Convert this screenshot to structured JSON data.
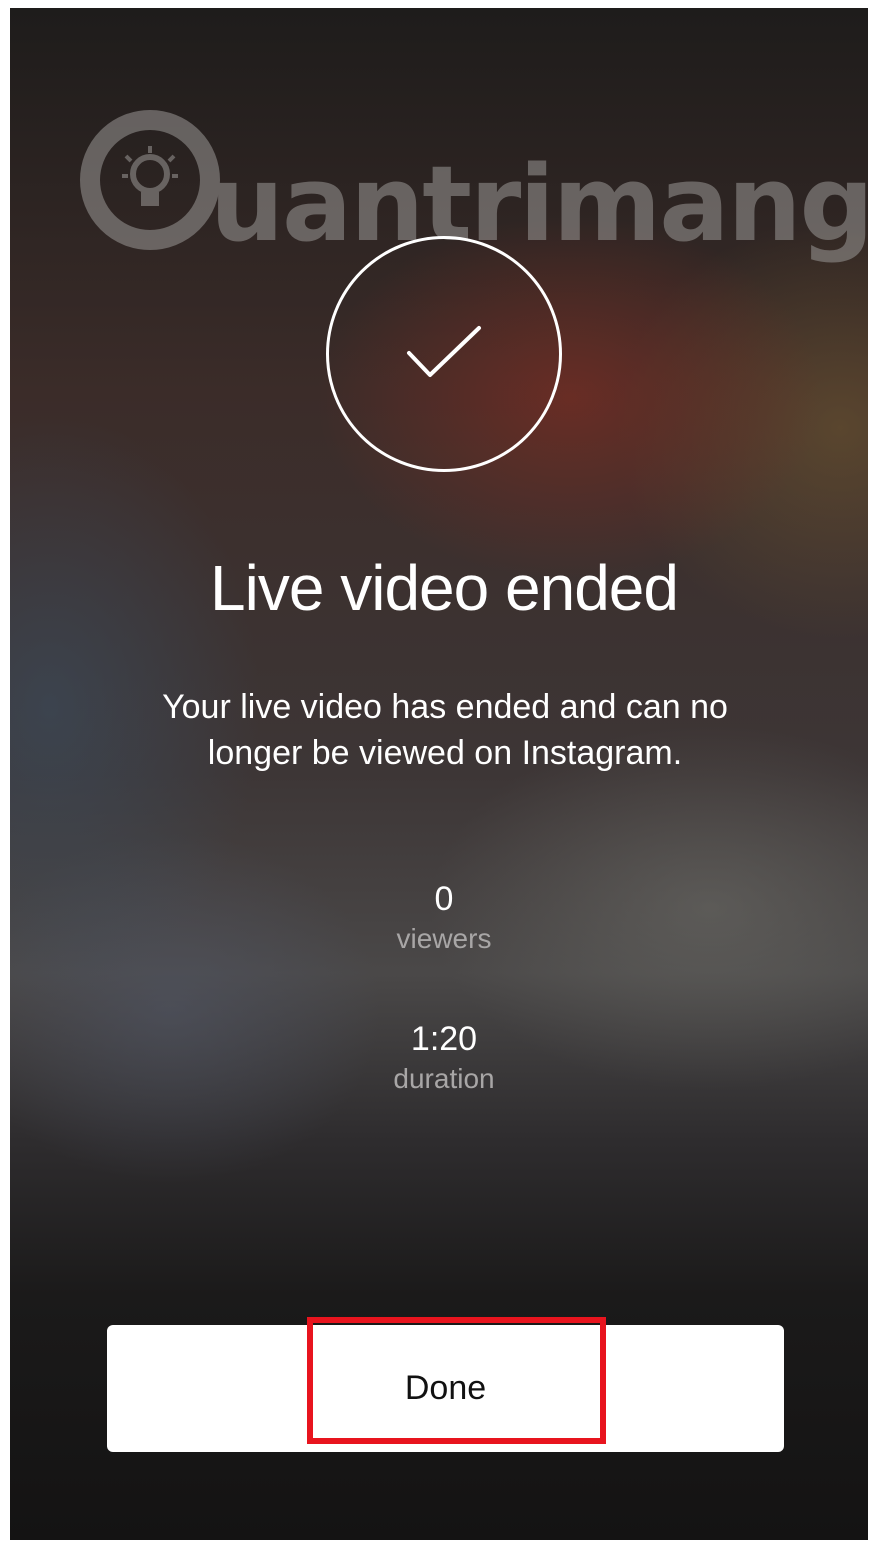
{
  "watermark": {
    "brand": "Quantrimang",
    "text_after_logo": "uantrimang",
    "icon": "lightbulb-icon"
  },
  "status_icon": "checkmark-icon",
  "title": "Live video ended",
  "message": "Your live video has ended and can no longer be viewed on Instagram.",
  "stats": {
    "viewers": {
      "value": "0",
      "label": "viewers"
    },
    "duration": {
      "value": "1:20",
      "label": "duration"
    }
  },
  "done_button": {
    "label": "Done"
  },
  "colors": {
    "highlight": "#e8141e",
    "button_background": "#ffffff",
    "text_primary": "#ffffff",
    "text_secondary": "#a8a6a6"
  }
}
